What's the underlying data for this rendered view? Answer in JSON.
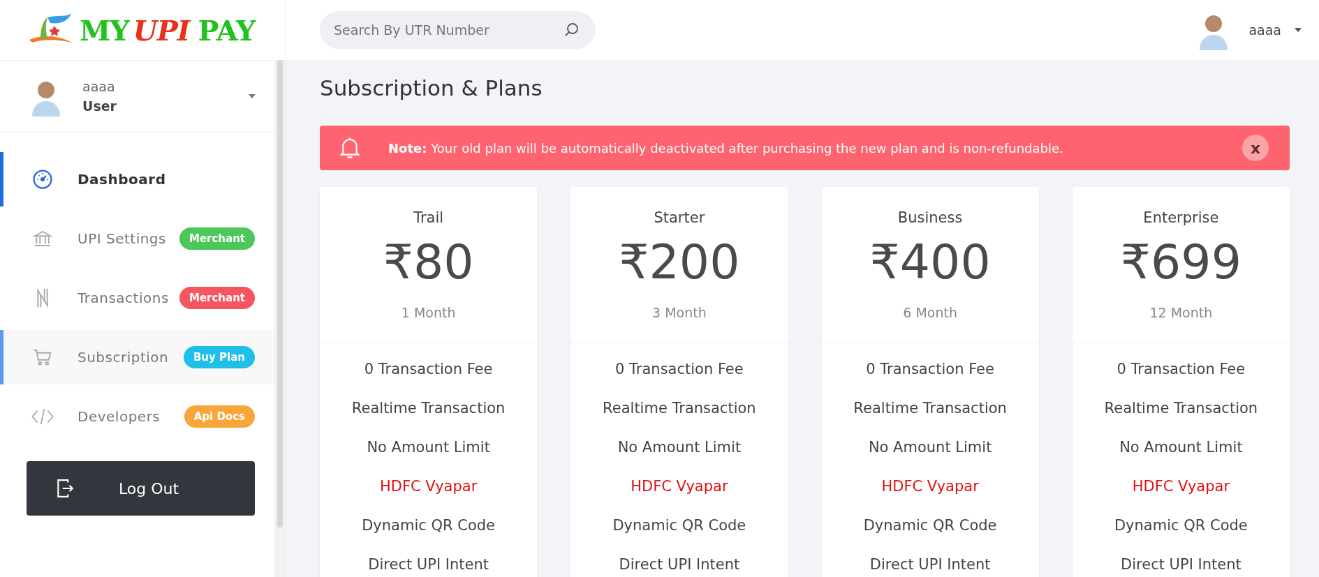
{
  "logo": {
    "parts": [
      {
        "text": "MY",
        "kind": "plain"
      },
      {
        "text": "UPI",
        "kind": "accent"
      },
      {
        "text": "PAY",
        "kind": "plain"
      }
    ]
  },
  "search": {
    "placeholder": "Search By UTR Number"
  },
  "header_user": {
    "name": "aaaa"
  },
  "sidebar": {
    "user": {
      "name": "aaaa",
      "role": "User"
    },
    "items": [
      {
        "label": "Dashboard",
        "active": true,
        "selected": false
      },
      {
        "label": "UPI Settings",
        "active": false,
        "selected": false,
        "badge": {
          "text": "Merchant",
          "color": "#4cc85a"
        }
      },
      {
        "label": "Transactions",
        "active": false,
        "selected": false,
        "badge": {
          "text": "Merchant",
          "color": "#f5555f"
        }
      },
      {
        "label": "Subscription",
        "active": false,
        "selected": true,
        "badge": {
          "text": "Buy Plan",
          "color": "#1ec0ea"
        }
      },
      {
        "label": "Developers",
        "active": false,
        "selected": false,
        "badge": {
          "text": "Api Docs",
          "color": "#f8a53a"
        }
      }
    ],
    "logout": "Log Out"
  },
  "page_title": "Subscription & Plans",
  "note": {
    "text": "**Note:** Your old plan will be automatically deactivated after purchasing the new plan and is non-refundable.",
    "close": "x"
  },
  "plans": [
    {
      "name": "Trail",
      "price": "₹80",
      "period": "1 Month",
      "features": [
        {
          "text": "0 Transaction Fee",
          "kind": "plain"
        },
        {
          "text": "Realtime Transaction",
          "kind": "plain"
        },
        {
          "text": "No Amount Limit",
          "kind": "plain"
        },
        {
          "text": "HDFC Vyapar",
          "kind": "bank"
        },
        {
          "text": "Dynamic QR Code",
          "kind": "plain"
        },
        {
          "text": "Direct UPI Intent",
          "kind": "plain"
        }
      ]
    },
    {
      "name": "Starter",
      "price": "₹200",
      "period": "3 Month",
      "features": [
        {
          "text": "0 Transaction Fee",
          "kind": "plain"
        },
        {
          "text": "Realtime Transaction",
          "kind": "plain"
        },
        {
          "text": "No Amount Limit",
          "kind": "plain"
        },
        {
          "text": "HDFC Vyapar",
          "kind": "bank"
        },
        {
          "text": "Dynamic QR Code",
          "kind": "plain"
        },
        {
          "text": "Direct UPI Intent",
          "kind": "plain"
        }
      ]
    },
    {
      "name": "Business",
      "price": "₹400",
      "period": "6 Month",
      "features": [
        {
          "text": "0 Transaction Fee",
          "kind": "plain"
        },
        {
          "text": "Realtime Transaction",
          "kind": "plain"
        },
        {
          "text": "No Amount Limit",
          "kind": "plain"
        },
        {
          "text": "HDFC Vyapar",
          "kind": "bank"
        },
        {
          "text": "Dynamic QR Code",
          "kind": "plain"
        },
        {
          "text": "Direct UPI Intent",
          "kind": "plain"
        }
      ]
    },
    {
      "name": "Enterprise",
      "price": "₹699",
      "period": "12 Month",
      "features": [
        {
          "text": "0 Transaction Fee",
          "kind": "plain"
        },
        {
          "text": "Realtime Transaction",
          "kind": "plain"
        },
        {
          "text": "No Amount Limit",
          "kind": "plain"
        },
        {
          "text": "HDFC Vyapar",
          "kind": "bank"
        },
        {
          "text": "Dynamic QR Code",
          "kind": "plain"
        },
        {
          "text": "Direct UPI Intent",
          "kind": "plain"
        }
      ]
    }
  ]
}
